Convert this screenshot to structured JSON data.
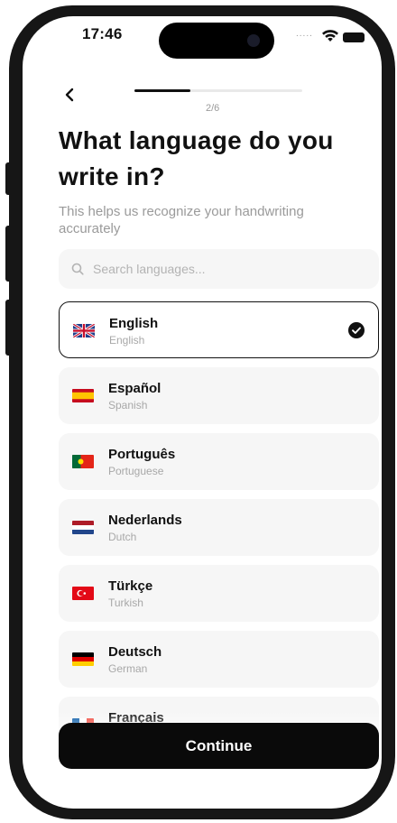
{
  "status_bar": {
    "time": "17:46",
    "signal_dots": "....."
  },
  "header": {
    "step": "2/6",
    "progress": 0.333
  },
  "title": "What language do you write in?",
  "subtitle": "This helps us recognize your handwriting accurately",
  "search": {
    "placeholder": "Search languages...",
    "value": ""
  },
  "languages": [
    {
      "native": "English",
      "english": "English",
      "flag": "uk-flag-icon",
      "selected": true
    },
    {
      "native": "Español",
      "english": "Spanish",
      "flag": "spain-flag-icon",
      "selected": false
    },
    {
      "native": "Português",
      "english": "Portuguese",
      "flag": "portugal-flag-icon",
      "selected": false
    },
    {
      "native": "Nederlands",
      "english": "Dutch",
      "flag": "netherlands-flag-icon",
      "selected": false
    },
    {
      "native": "Türkçe",
      "english": "Turkish",
      "flag": "turkey-flag-icon",
      "selected": false
    },
    {
      "native": "Deutsch",
      "english": "German",
      "flag": "germany-flag-icon",
      "selected": false
    },
    {
      "native": "Français",
      "english": "",
      "flag": "france-flag-icon",
      "selected": false
    }
  ],
  "continue_label": "Continue",
  "colors": {
    "primary": "#0a0a0a",
    "card_bg": "#f6f6f6",
    "muted_text": "#9a9a9a"
  }
}
